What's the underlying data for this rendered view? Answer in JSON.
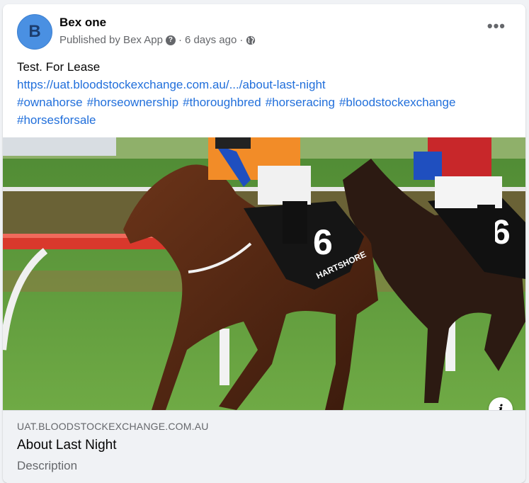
{
  "post": {
    "author": "Bex one",
    "avatar_initial": "B",
    "published_by": "Published by Bex App",
    "separator1": "·",
    "time": "6 days ago",
    "separator2": "·",
    "more_label": "•••",
    "text_line": "Test. For Lease",
    "link": "https://uat.bloodstockexchange.com.au/.../about-last-night",
    "hashtags": [
      "#ownahorse",
      "#horseownership",
      "#thoroughbred",
      "#horseracing",
      "#bloodstockexchange",
      "#horsesforsale"
    ]
  },
  "link_preview": {
    "domain": "UAT.BLOODSTOCKEXCHANGE.COM.AU",
    "title": "About Last Night",
    "description": "Description",
    "info_label": "i",
    "cloth_number": "6",
    "saddle_text": "HARTSHORE"
  },
  "colors": {
    "link": "#216fdb",
    "avatar": "#4a90e2",
    "secondary_text": "#65676b",
    "preview_bg": "#f0f2f5"
  }
}
